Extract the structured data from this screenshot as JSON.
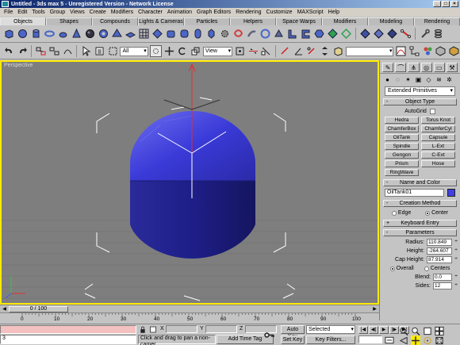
{
  "window": {
    "title": "Untitled - 3ds max 5 - Unregistered Version - Network License",
    "minimize": "_",
    "maximize": "□",
    "close": "×"
  },
  "menu": [
    "File",
    "Edit",
    "Tools",
    "Group",
    "Views",
    "Create",
    "Modifiers",
    "Character",
    "Animation",
    "Graph Editors",
    "Rendering",
    "Customize",
    "MAXScript",
    "Help"
  ],
  "tabs": [
    "Objects",
    "Shapes",
    "Compounds",
    "Lights & Cameras",
    "Particles",
    "Helpers",
    "Space Warps",
    "Modifiers",
    "Modeling",
    "Rendering"
  ],
  "toolbar": {
    "selection_filter": "All",
    "reference_coord": "View"
  },
  "viewport": {
    "label": "Perspective"
  },
  "command_panel": {
    "category": "Extended Primitives",
    "object_type_title": "Object Type",
    "autogrid_label": "AutoGrid",
    "object_buttons": [
      "Hedra",
      "Torus Knot",
      "ChamferBox",
      "ChamferCyl",
      "OilTank",
      "Capsule",
      "Spindle",
      "L-Ext",
      "Gengon",
      "C-Ext",
      "Prism",
      "Hose",
      "RingWave"
    ],
    "name_color_title": "Name and Color",
    "object_name": "OilTank01",
    "object_color": "#4040e0",
    "creation_method_title": "Creation Method",
    "creation_edge": "Edge",
    "creation_center": "Center",
    "keyboard_entry_title": "Keyboard Entry",
    "parameters_title": "Parameters",
    "radius_label": "Radius:",
    "radius_value": "110.849",
    "height_label": "Height:",
    "height_value": "-264.607",
    "cap_height_label": "Cap Height:",
    "cap_height_value": "87.914",
    "overall_label": "Overall",
    "centers_label": "Centers",
    "blend_label": "Blend:",
    "blend_value": "0.0",
    "sides_label": "Sides:",
    "sides_value": "12"
  },
  "timeline": {
    "frame_display": "0 / 100",
    "ticks": [
      "0",
      "10",
      "20",
      "30",
      "40",
      "50",
      "60",
      "70",
      "80",
      "90",
      "100"
    ]
  },
  "status": {
    "maxscript_value": "3",
    "prompt": "Click and drag to pan a non-camer...",
    "x_label": "X",
    "y_label": "Y",
    "z_label": "Z",
    "add_time_tag": "Add Time Tag",
    "auto_key": "Auto Key",
    "set_key": "Set Key",
    "key_mode": "Selected",
    "key_filters": "Key Filters..."
  }
}
